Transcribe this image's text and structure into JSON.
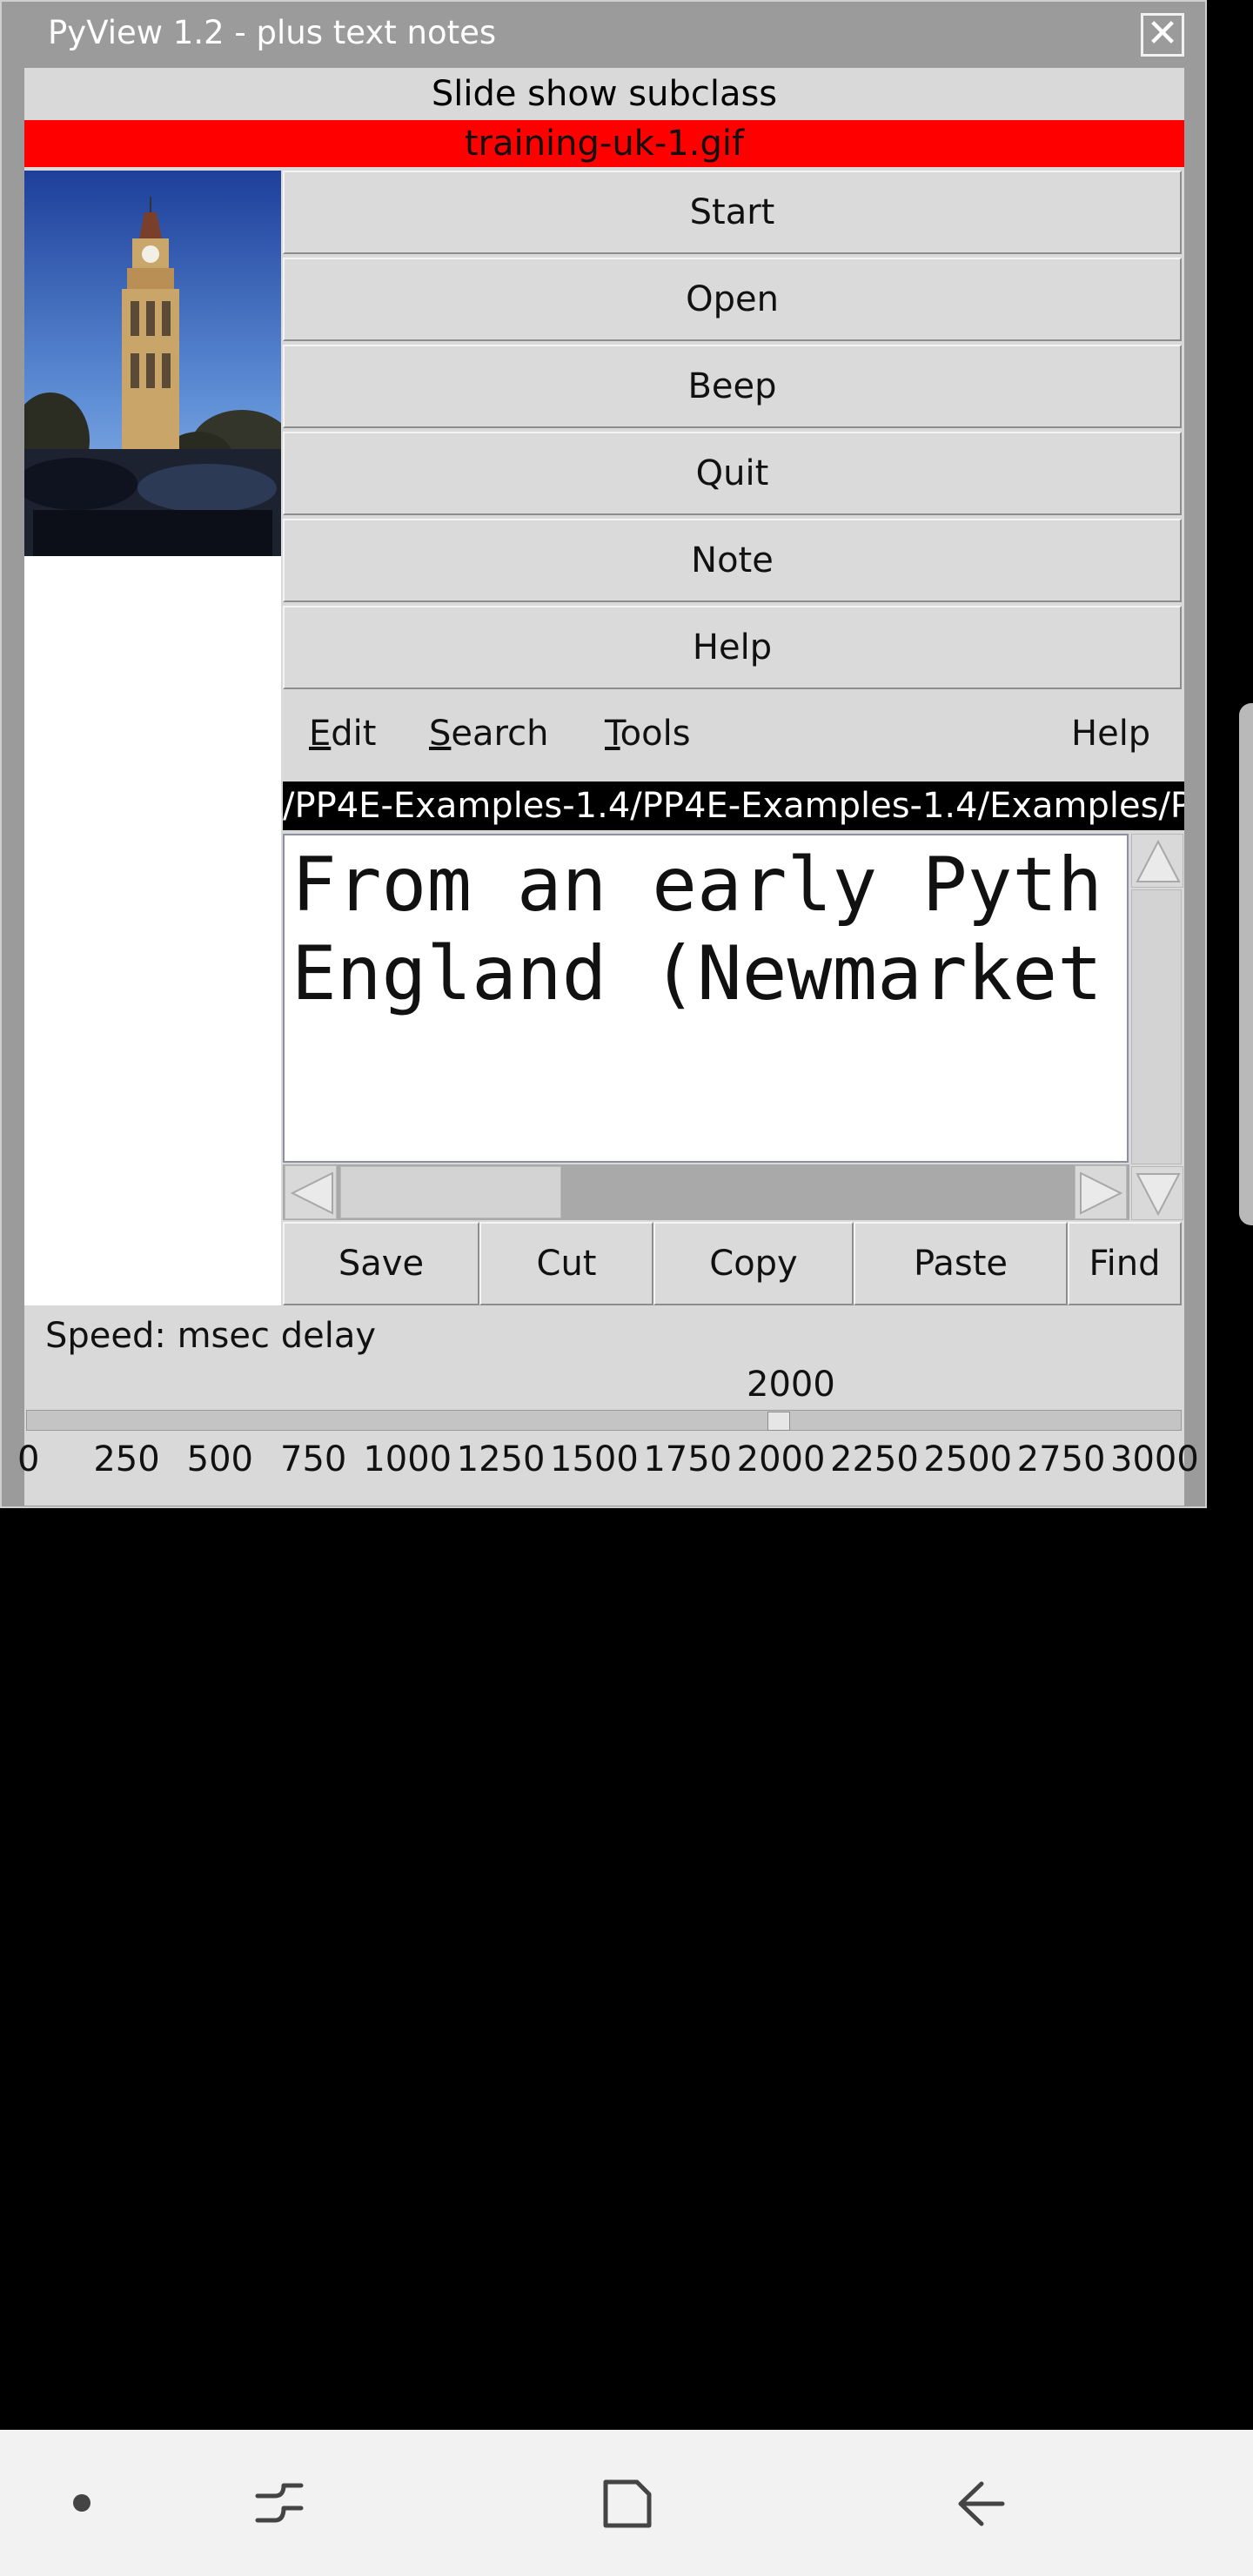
{
  "window": {
    "title": "PyView 1.2 - plus text notes",
    "close_glyph": "✕"
  },
  "slideshow": {
    "caption": "Slide show subclass",
    "filename": "training-uk-1.gif"
  },
  "buttons": [
    "Start",
    "Open",
    "Beep",
    "Quit",
    "Note",
    "Help"
  ],
  "menu": {
    "edit": {
      "underline": "E",
      "rest": "dit"
    },
    "search": {
      "underline": "S",
      "rest": "earch"
    },
    "tools": {
      "underline": "T",
      "rest": "ools"
    },
    "help": "Help"
  },
  "editor": {
    "path": "/PP4E-Examples-1.4/PP4E-Examples-1.4/Examples/P",
    "lines": [
      "From an early Pyth",
      "England (Newmarket"
    ]
  },
  "edit_buttons": [
    "Save",
    "Cut",
    "Copy",
    "Paste",
    "Find"
  ],
  "speed": {
    "label": "Speed: msec delay",
    "value": "2000",
    "value_num": 2000,
    "min": 0,
    "max": 3000,
    "ticks": [
      "0",
      "250",
      "500",
      "750",
      "1000",
      "1250",
      "1500",
      "1750",
      "2000",
      "2250",
      "2500",
      "2750",
      "3000"
    ]
  },
  "navbar": {
    "icons": [
      "recent-dot-icon",
      "recents-icon",
      "home-icon",
      "back-icon"
    ]
  }
}
